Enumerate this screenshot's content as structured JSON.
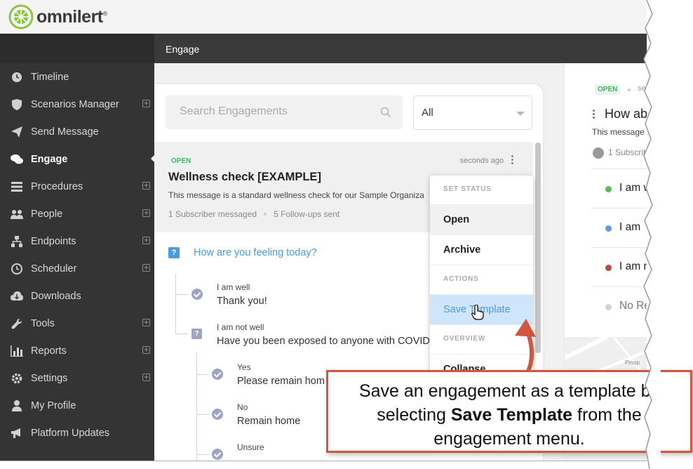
{
  "brand": {
    "logo_text": "omnilert",
    "logo_mark": "®",
    "logo_color": "#8cc63f"
  },
  "header": {
    "title": "Engage"
  },
  "sidebar": {
    "items": [
      {
        "label": "Timeline",
        "icon": "clock-arrow-icon",
        "expandable": false,
        "active": false
      },
      {
        "label": "Scenarios Manager",
        "icon": "shield-icon",
        "expandable": true,
        "active": false
      },
      {
        "label": "Send Message",
        "icon": "paper-plane-icon",
        "expandable": false,
        "active": false
      },
      {
        "label": "Engage",
        "icon": "chat-bubbles-icon",
        "expandable": false,
        "active": true
      },
      {
        "label": "Procedures",
        "icon": "list-icon",
        "expandable": true,
        "active": false
      },
      {
        "label": "People",
        "icon": "users-icon",
        "expandable": true,
        "active": false
      },
      {
        "label": "Endpoints",
        "icon": "sitemap-icon",
        "expandable": true,
        "active": false
      },
      {
        "label": "Scheduler",
        "icon": "clock-icon",
        "expandable": true,
        "active": false
      },
      {
        "label": "Downloads",
        "icon": "cloud-download-icon",
        "expandable": false,
        "active": false
      },
      {
        "label": "Tools",
        "icon": "wrench-icon",
        "expandable": true,
        "active": false
      },
      {
        "label": "Reports",
        "icon": "bar-chart-icon",
        "expandable": true,
        "active": false
      },
      {
        "label": "Settings",
        "icon": "gear-icon",
        "expandable": true,
        "active": false
      },
      {
        "label": "My Profile",
        "icon": "user-icon",
        "expandable": false,
        "active": false
      },
      {
        "label": "Platform Updates",
        "icon": "bullhorn-icon",
        "expandable": false,
        "active": false
      }
    ]
  },
  "search": {
    "placeholder": "Search Engagements"
  },
  "filter": {
    "selected": "All"
  },
  "engagement": {
    "status": "OPEN",
    "time": "seconds ago",
    "title": "Wellness check [EXAMPLE]",
    "description": "This message is a standard wellness check for our Sample Organiza",
    "subscribers": "1 Subscriber messaged",
    "followups": "5 Follow-ups sent",
    "question": "How are you feeling today?",
    "responses": [
      {
        "label": "I am well",
        "text": "Thank you!"
      },
      {
        "label": "I am not well",
        "text": "Have you been exposed to anyone with COVID-"
      }
    ],
    "sub_responses": [
      {
        "label": "Yes",
        "text": "Please remain hom"
      },
      {
        "label": "No",
        "text": "Remain home"
      },
      {
        "label": "Unsure",
        "text": ""
      }
    ]
  },
  "menu": {
    "set_status_heading": "SET STATUS",
    "open": "Open",
    "archive": "Archive",
    "actions_heading": "ACTIONS",
    "save_template": "Save Template",
    "overview_heading": "OVERVIEW",
    "collapse": "Collapse"
  },
  "detail": {
    "status": "OPEN",
    "time_fragment": "se",
    "title_fragment": "How ab",
    "description_fragment": "This message",
    "subscribers_fragment": "1 Subscrib",
    "options": [
      {
        "text": "I am w",
        "color": "#5cb85c"
      },
      {
        "text": "I am",
        "color": "#5b9bf0"
      },
      {
        "text": "I am n",
        "color": "#c9443c"
      },
      {
        "text": "No Re",
        "color": "#cfcfe6"
      }
    ],
    "map_labels": [
      "Prosp"
    ]
  },
  "annotation": {
    "line1": "Save an engagement as a template by",
    "line2_prefix": "selecting ",
    "line2_bold": "Save Template",
    "line2_suffix": " from the",
    "line3": "engagement menu.",
    "border_color": "#d3553d"
  }
}
